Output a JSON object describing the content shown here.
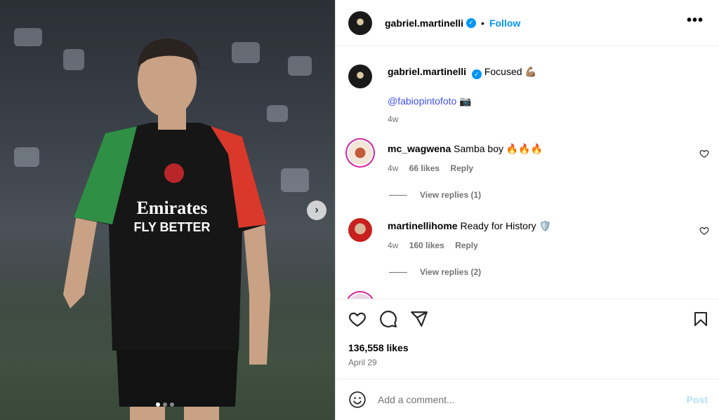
{
  "post": {
    "username": "gabriel.martinelli",
    "follow_label": "Follow",
    "separator": "•",
    "more_label": "•••",
    "caption_text": "Focused 💪🏽",
    "caption_mention": "@fabiopintofoto",
    "caption_emoji": "📷",
    "caption_age": "4w",
    "likes": "136,558 likes",
    "date": "April 29"
  },
  "comments": [
    {
      "username": "mc_wagwena",
      "text": "Samba boy 🔥🔥🔥",
      "age": "4w",
      "likes": "66 likes",
      "reply_label": "Reply",
      "view_replies": "View replies (1)"
    },
    {
      "username": "martinellihome",
      "text": "Ready for History 🛡️",
      "age": "4w",
      "likes": "160 likes",
      "reply_label": "Reply",
      "view_replies": "View replies (2)"
    }
  ],
  "composer": {
    "placeholder": "Add a comment...",
    "post_label": "Post"
  },
  "icons": {
    "verified": "verified-badge-icon",
    "next": "chevron-right-icon",
    "like": "heart-icon",
    "comment": "comment-bubble-icon",
    "share": "paper-plane-icon",
    "save": "bookmark-icon",
    "emoji": "smiley-icon"
  },
  "colors": {
    "accent": "#0095f6",
    "muted": "#737373",
    "post_disabled": "#b2dffc"
  },
  "carousel": {
    "current": 1,
    "total": 3
  }
}
